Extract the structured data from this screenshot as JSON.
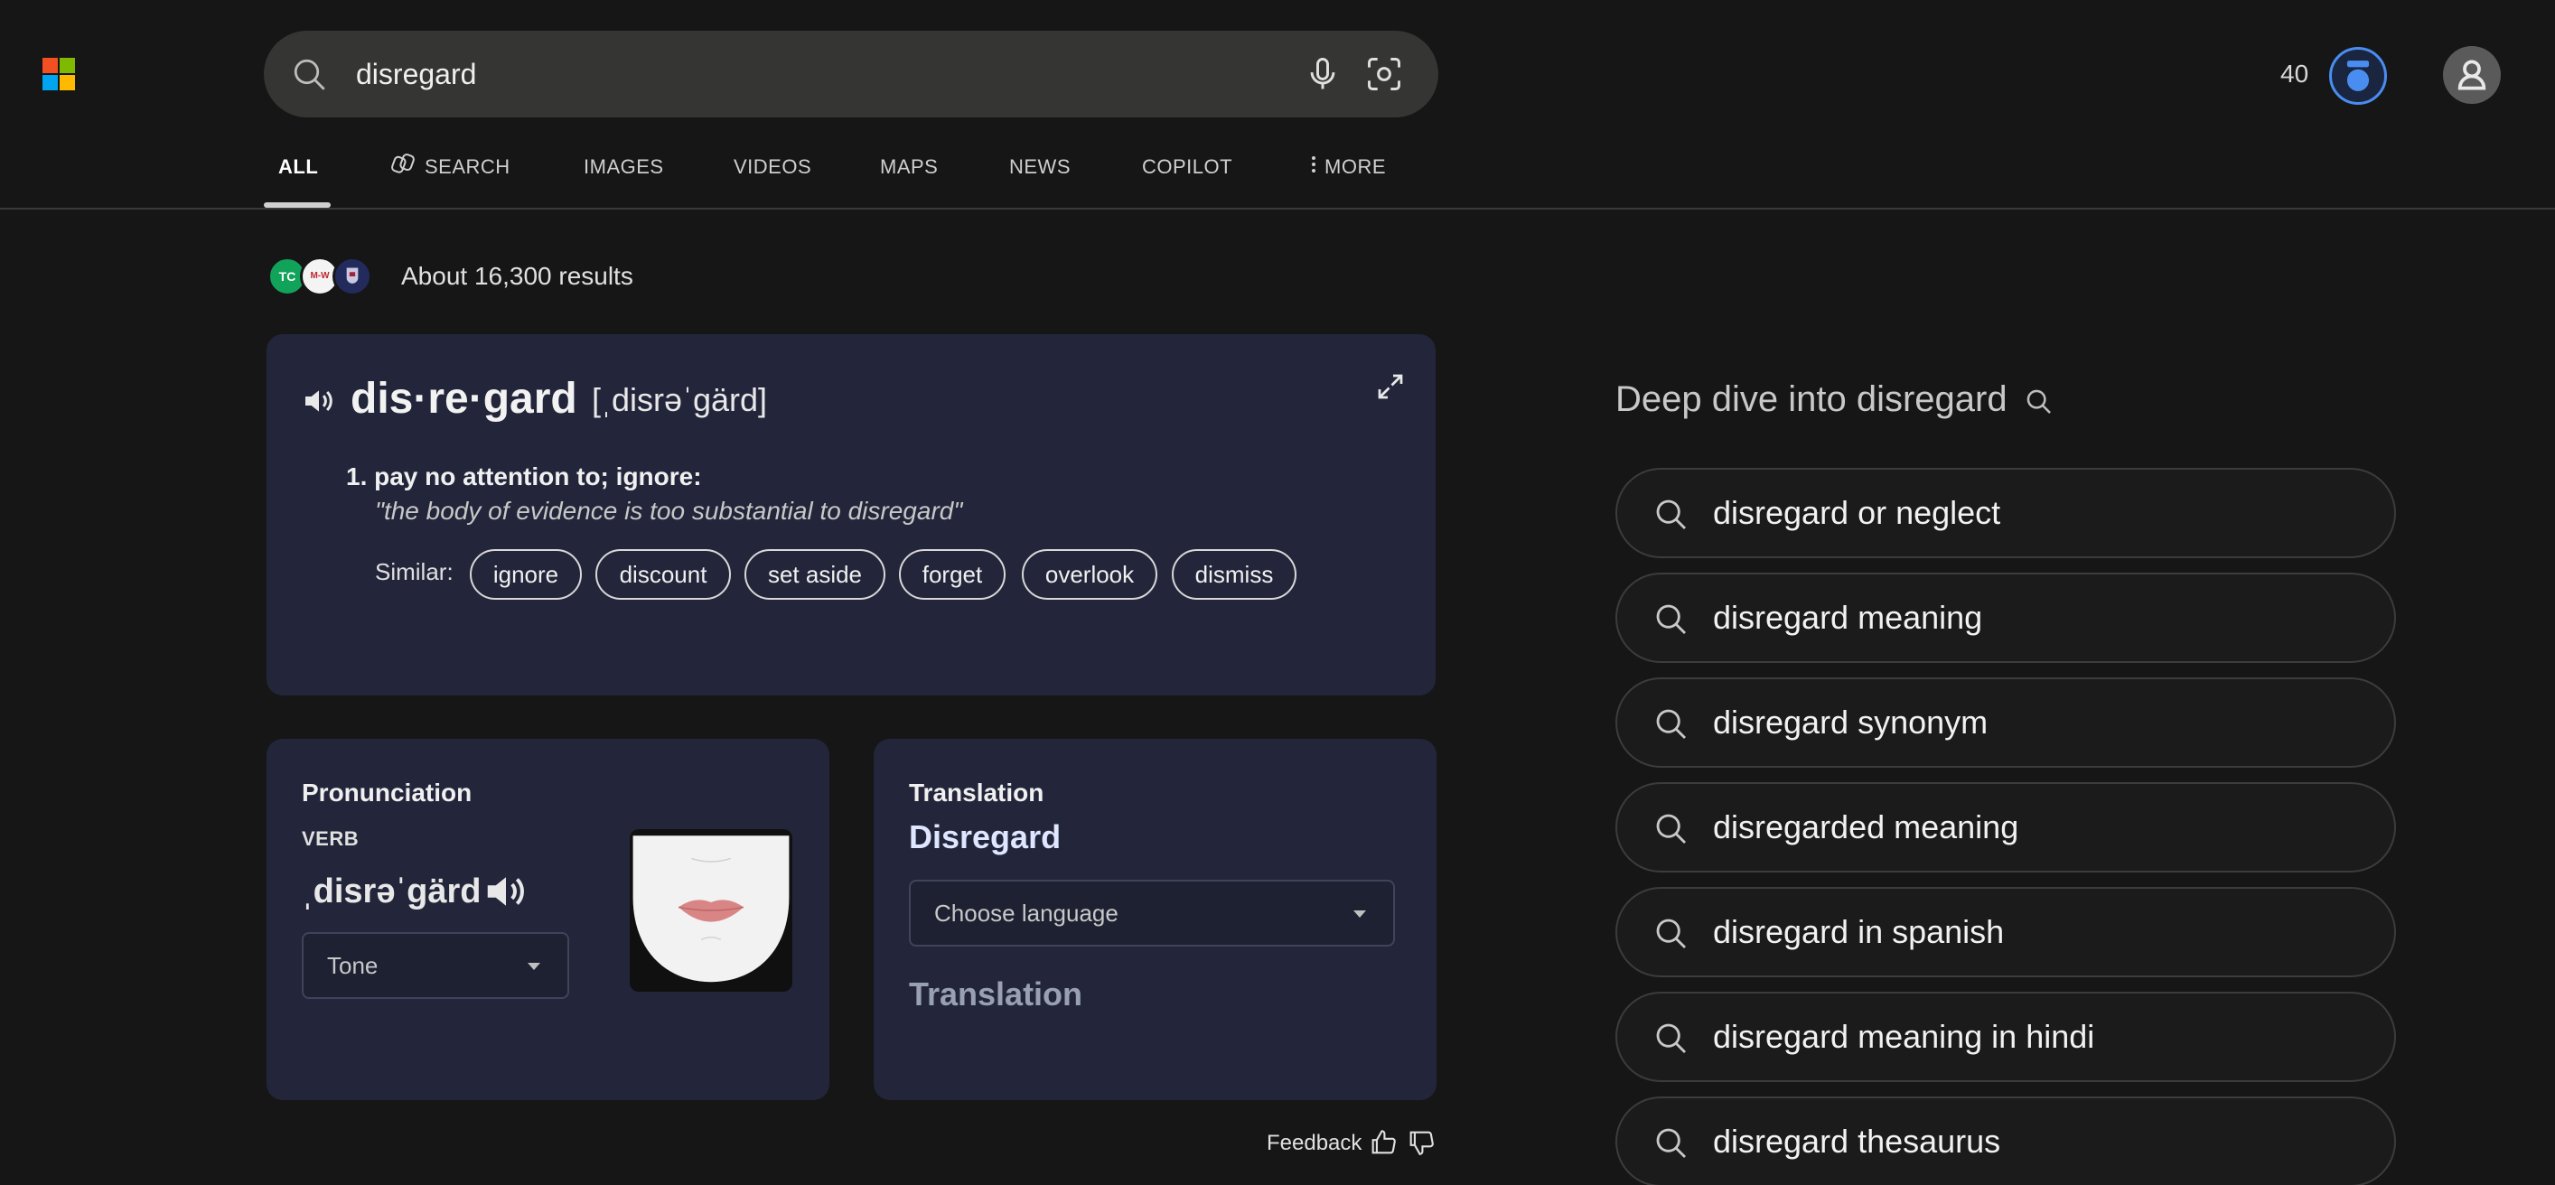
{
  "header": {
    "search_value": "disregard",
    "points": "40"
  },
  "nav": [
    {
      "label": "ALL",
      "active": true
    },
    {
      "label": "SEARCH"
    },
    {
      "label": "IMAGES"
    },
    {
      "label": "VIDEOS"
    },
    {
      "label": "MAPS"
    },
    {
      "label": "NEWS"
    },
    {
      "label": "COPILOT"
    },
    {
      "label": "MORE"
    }
  ],
  "results": {
    "count_text": "About 16,300 results",
    "sources": [
      "TC",
      "M-W",
      "Oxford"
    ]
  },
  "definition": {
    "word": "dis·re·gard",
    "phonetic": "[ˌdisrəˈɡärd]",
    "sense": "1. pay no attention to; ignore:",
    "example": "\"the body of evidence is too substantial to disregard\"",
    "similar_label": "Similar:",
    "similar": [
      "ignore",
      "discount",
      "set aside",
      "forget",
      "overlook",
      "dismiss"
    ]
  },
  "pronunciation": {
    "title": "Pronunciation",
    "pos": "VERB",
    "text": "ˌdisrəˈɡärd",
    "tone_placeholder": "Tone"
  },
  "translation": {
    "title": "Translation",
    "word": "Disregard",
    "language_placeholder": "Choose language",
    "output_placeholder": "Translation"
  },
  "feedback": {
    "label": "Feedback"
  },
  "deep_dive": {
    "title": "Deep dive into disregard",
    "items": [
      "disregard or neglect",
      "disregard meaning",
      "disregard synonym",
      "disregarded meaning",
      "disregard in spanish",
      "disregard meaning in hindi",
      "disregard thesaurus"
    ]
  },
  "colors": {
    "background": "#161616",
    "card": "#23263a",
    "accent_blue": "#4a8df0"
  }
}
